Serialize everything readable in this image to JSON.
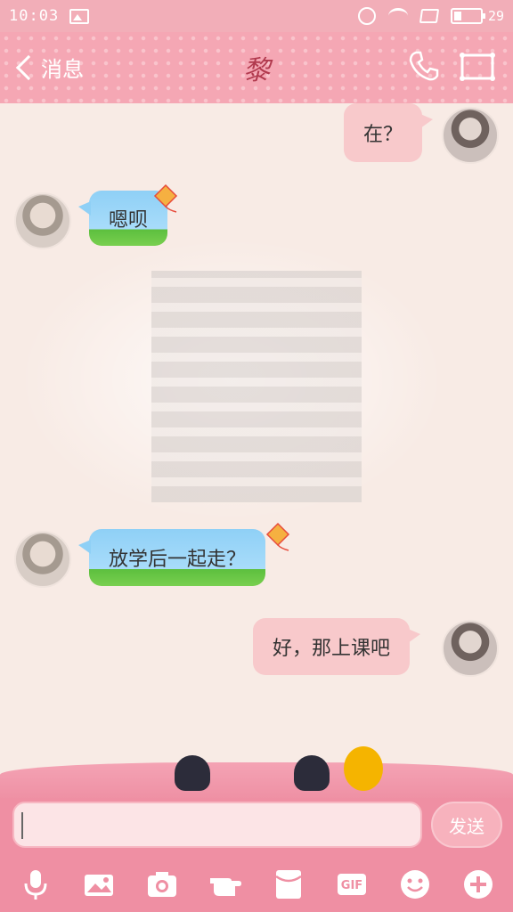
{
  "status_bar": {
    "time": "10:03",
    "battery_text": "29",
    "battery_level": 0.29
  },
  "header": {
    "back_label": "消息",
    "title": "黎"
  },
  "messages": [
    {
      "dir": "out",
      "text": "在？"
    },
    {
      "dir": "in",
      "text": "嗯呗"
    },
    {
      "dir": "in",
      "text": "放学后一起走？"
    },
    {
      "dir": "out",
      "text": "好，那上课吧"
    }
  ],
  "composer": {
    "input_value": "",
    "send_label": "发送"
  },
  "toolbar": [
    "microphone-icon",
    "photo-album-icon",
    "camera-icon",
    "pointing-hand-icon",
    "red-envelope-icon",
    "gif-icon",
    "emoji-icon",
    "plus-icon"
  ],
  "toolbar_gif_text": "GIF",
  "colors": {
    "accent": "#ef8fa3",
    "title": "#b13a4e",
    "bubble_out": "#f8c9cb",
    "bubble_in": "#8fd0f6"
  }
}
